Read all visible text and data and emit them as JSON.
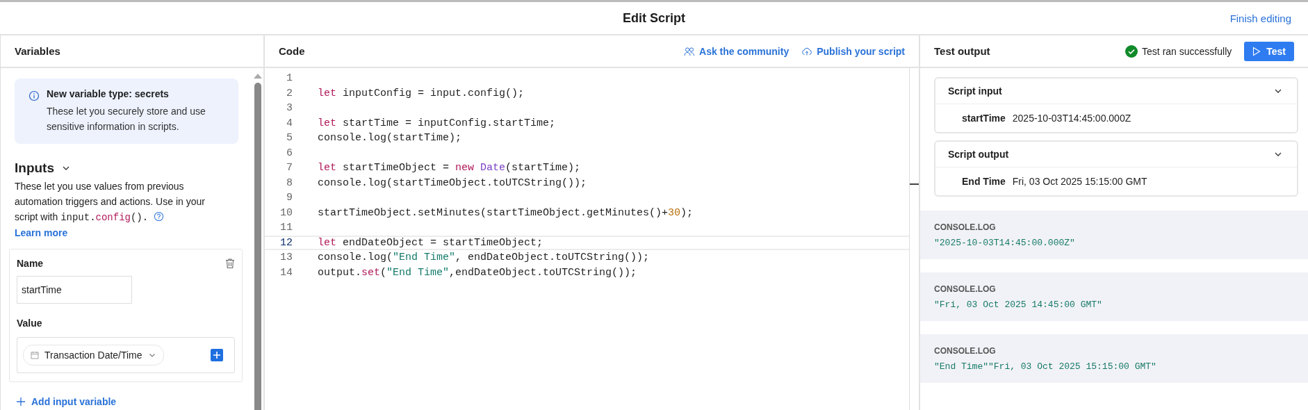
{
  "window": {
    "title": "Edit Script",
    "finish_link": "Finish editing"
  },
  "variables": {
    "heading": "Variables",
    "callout": {
      "title": "New variable type: secrets",
      "body": "These let you securely store and use sensitive information in scripts."
    },
    "inputs": {
      "heading": "Inputs",
      "expanded": true,
      "description": {
        "text": "These let you use values from previous automation triggers and actions. Use in your script with",
        "code": [
          {
            "text": "input.",
            "kind": "plain"
          },
          {
            "text": "config",
            "kind": "keyword"
          },
          {
            "text": "().",
            "kind": "plain"
          }
        ],
        "link": "Learn more"
      },
      "items": [
        {
          "name_label": "Name",
          "name_value": "startTime",
          "value_label": "Value",
          "value_token": "Transaction Date/Time"
        }
      ],
      "add_link": "Add input variable"
    }
  },
  "code": {
    "heading": "Code",
    "actions": [
      "Ask the community",
      "Publish your script"
    ],
    "lines": [
      {
        "number": "1",
        "current": false
      },
      {
        "number": "2",
        "current": false,
        "tokens": [
          {
            "text": "let",
            "kind": "keyword"
          },
          {
            "text": " inputConfig = input.config();",
            "kind": "plain"
          }
        ]
      },
      {
        "number": "3",
        "current": false
      },
      {
        "number": "4",
        "current": false,
        "tokens": [
          {
            "text": "let",
            "kind": "keyword"
          },
          {
            "text": " startTime = inputConfig.startTime;",
            "kind": "plain"
          }
        ]
      },
      {
        "number": "5",
        "current": false,
        "tokens": [
          {
            "text": "console.log(startTime);",
            "kind": "plain"
          }
        ]
      },
      {
        "number": "6",
        "current": false
      },
      {
        "number": "7",
        "current": false,
        "tokens": [
          {
            "text": "let",
            "kind": "keyword"
          },
          {
            "text": " startTimeObject = ",
            "kind": "plain"
          },
          {
            "text": "new",
            "kind": "keyword"
          },
          {
            "text": " Date",
            "kind": "type"
          },
          {
            "text": "(startTime);",
            "kind": "plain"
          }
        ]
      },
      {
        "number": "8",
        "current": false,
        "tokens": [
          {
            "text": "console.log(startTimeObject.toUTCString());",
            "kind": "plain"
          }
        ]
      },
      {
        "number": "9",
        "current": false
      },
      {
        "number": "10",
        "current": false,
        "tokens": [
          {
            "text": "startTimeObject.setMinutes(startTimeObject.getMinutes()+",
            "kind": "plain"
          },
          {
            "text": "30",
            "kind": "number"
          },
          {
            "text": ");",
            "kind": "plain"
          }
        ]
      },
      {
        "number": "11",
        "current": false
      },
      {
        "number": "12",
        "current": true,
        "tokens": [
          {
            "text": "let",
            "kind": "keyword"
          },
          {
            "text": " endDateObject = startTimeObject;",
            "kind": "plain"
          }
        ]
      },
      {
        "number": "13",
        "current": false,
        "tokens": [
          {
            "text": "console.log(",
            "kind": "plain"
          },
          {
            "text": "\"End Time\"",
            "kind": "string"
          },
          {
            "text": ", endDateObject.toUTCString());",
            "kind": "plain"
          }
        ]
      },
      {
        "number": "14",
        "current": false,
        "tokens": [
          {
            "text": "output.",
            "kind": "plain"
          },
          {
            "text": "set",
            "kind": "keyword"
          },
          {
            "text": "(",
            "kind": "plain"
          },
          {
            "text": "\"End Time\"",
            "kind": "string"
          },
          {
            "text": ",endDateObject.toUTCString());",
            "kind": "plain"
          }
        ]
      }
    ]
  },
  "test_output": {
    "heading": "Test output",
    "status": "Test ran successfully",
    "success": true,
    "button": "Test",
    "sections": [
      {
        "title": "Script input",
        "expanded": true,
        "rows": [
          {
            "key": "startTime",
            "value": "2025-10-03T14:45:00.000Z"
          }
        ]
      },
      {
        "title": "Script output",
        "expanded": true,
        "rows": [
          {
            "key": "End Time",
            "value": "Fri, 03 Oct 2025 15:15:00 GMT"
          }
        ]
      }
    ],
    "logs": [
      {
        "label": "CONSOLE.LOG",
        "text": "\"2025-10-03T14:45:00.000Z\""
      },
      {
        "label": "CONSOLE.LOG",
        "text": "\"Fri, 03 Oct 2025 14:45:00 GMT\""
      },
      {
        "label": "CONSOLE.LOG",
        "text": "\"End Time\"\"Fri, 03 Oct 2025 15:15:00 GMT\""
      }
    ]
  }
}
